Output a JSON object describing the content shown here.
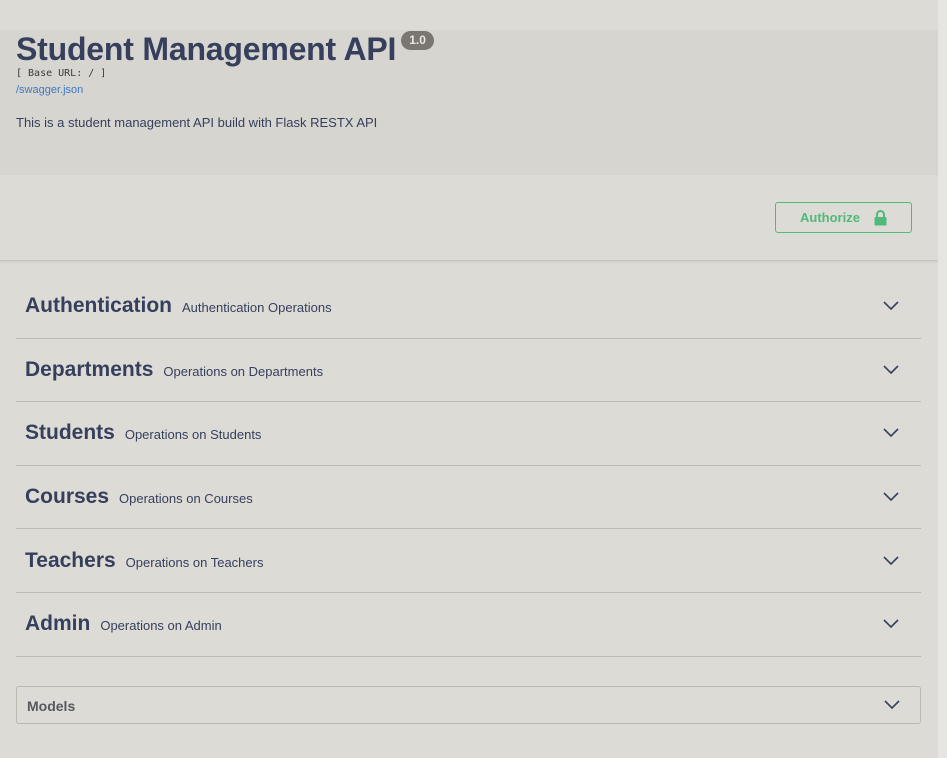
{
  "info": {
    "title": "Student Management API",
    "version": "1.0",
    "base_url": "[ Base URL: / ]",
    "swagger_link": "/swagger.json",
    "description": "This is a student management API build with Flask RESTX API"
  },
  "authorize": {
    "label": "Authorize",
    "icon": "lock-icon",
    "color": "#4fba7a"
  },
  "tags": [
    {
      "name": "Authentication",
      "description": "Authentication Operations"
    },
    {
      "name": "Departments",
      "description": "Operations on Departments"
    },
    {
      "name": "Students",
      "description": "Operations on Students"
    },
    {
      "name": "Courses",
      "description": "Operations on Courses"
    },
    {
      "name": "Teachers",
      "description": "Operations on Teachers"
    },
    {
      "name": "Admin",
      "description": "Operations on Admin"
    }
  ],
  "models": {
    "title": "Models"
  },
  "colors": {
    "text": "#363f5c",
    "background": "#dcdbd6",
    "version_badge": "#7b7670",
    "link": "#3e78c6"
  }
}
